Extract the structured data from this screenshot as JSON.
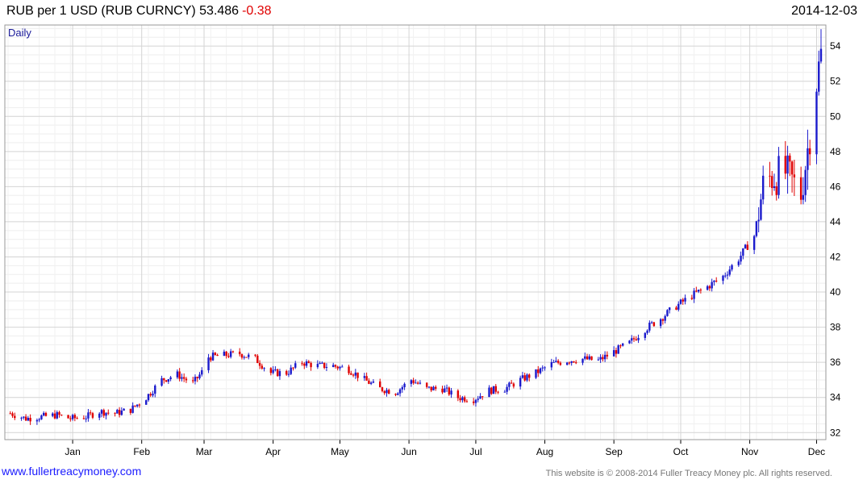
{
  "header": {
    "title": "RUB per 1 USD (RUB CURNCY) 53.486",
    "change": "-0.38",
    "date": "2014-12-03"
  },
  "footer": {
    "website": "www.fullertreacymoney.com",
    "copyright": "This website is © 2008-2014 Fuller Treacy Money plc. All rights reserved."
  },
  "colors": {
    "up": "#1a1acc",
    "down": "#e00000",
    "grid": "#d4d4d4"
  },
  "chart_data": {
    "type": "candlestick",
    "period": "Daily",
    "ylim": [
      31.6,
      55.2
    ],
    "yticks": [
      32,
      34,
      36,
      38,
      40,
      42,
      44,
      46,
      48,
      50,
      52,
      54
    ],
    "xlim": [
      "2013-12-03",
      "2014-12-03"
    ],
    "xticks": [
      {
        "label": "Jan",
        "date": "2014-01-01"
      },
      {
        "label": "Feb",
        "date": "2014-02-01"
      },
      {
        "label": "Mar",
        "date": "2014-03-01"
      },
      {
        "label": "Apr",
        "date": "2014-04-01"
      },
      {
        "label": "May",
        "date": "2014-05-01"
      },
      {
        "label": "Jun",
        "date": "2014-06-01"
      },
      {
        "label": "Jul",
        "date": "2014-07-01"
      },
      {
        "label": "Aug",
        "date": "2014-08-01"
      },
      {
        "label": "Sep",
        "date": "2014-09-01"
      },
      {
        "label": "Oct",
        "date": "2014-10-01"
      },
      {
        "label": "Nov",
        "date": "2014-11-01"
      },
      {
        "label": "Dec",
        "date": "2014-12-01"
      }
    ],
    "closes": [
      [
        "2013-12-04",
        33.1
      ],
      [
        "2013-12-11",
        32.8
      ],
      [
        "2013-12-18",
        32.9
      ],
      [
        "2013-12-25",
        33.0
      ],
      [
        "2013-12-31",
        32.8
      ],
      [
        "2014-01-07",
        32.9
      ],
      [
        "2014-01-13",
        33.2
      ],
      [
        "2014-01-20",
        33.1
      ],
      [
        "2014-01-27",
        33.3
      ],
      [
        "2014-02-03",
        34.0
      ],
      [
        "2014-02-10",
        35.0
      ],
      [
        "2014-02-17",
        35.3
      ],
      [
        "2014-02-24",
        34.8
      ],
      [
        "2014-03-01",
        35.6
      ],
      [
        "2014-03-03",
        36.3
      ],
      [
        "2014-03-10",
        36.4
      ],
      [
        "2014-03-17",
        36.5
      ],
      [
        "2014-03-24",
        36.2
      ],
      [
        "2014-03-31",
        35.4
      ],
      [
        "2014-04-07",
        35.4
      ],
      [
        "2014-04-14",
        36.0
      ],
      [
        "2014-04-21",
        35.8
      ],
      [
        "2014-04-28",
        35.8
      ],
      [
        "2014-05-05",
        35.6
      ],
      [
        "2014-05-12",
        35.0
      ],
      [
        "2014-05-19",
        34.5
      ],
      [
        "2014-05-26",
        34.3
      ],
      [
        "2014-06-02",
        35.0
      ],
      [
        "2014-06-09",
        34.5
      ],
      [
        "2014-06-16",
        34.5
      ],
      [
        "2014-06-23",
        34.0
      ],
      [
        "2014-06-30",
        33.9
      ],
      [
        "2014-07-07",
        34.4
      ],
      [
        "2014-07-14",
        34.5
      ],
      [
        "2014-07-21",
        35.0
      ],
      [
        "2014-07-28",
        35.4
      ],
      [
        "2014-08-04",
        35.9
      ],
      [
        "2014-08-11",
        36.1
      ],
      [
        "2014-08-18",
        36.2
      ],
      [
        "2014-08-25",
        36.1
      ],
      [
        "2014-09-01",
        36.6
      ],
      [
        "2014-09-08",
        37.1
      ],
      [
        "2014-09-15",
        37.9
      ],
      [
        "2014-09-22",
        38.5
      ],
      [
        "2014-09-29",
        39.2
      ],
      [
        "2014-10-06",
        39.8
      ],
      [
        "2014-10-13",
        40.3
      ],
      [
        "2014-10-20",
        40.9
      ],
      [
        "2014-10-27",
        41.9
      ],
      [
        "2014-11-03",
        43.2
      ],
      [
        "2014-11-07",
        46.0
      ],
      [
        "2014-11-10",
        46.5
      ],
      [
        "2014-11-17",
        46.8
      ],
      [
        "2014-11-24",
        45.6
      ],
      [
        "2014-11-28",
        49.0
      ],
      [
        "2014-12-01",
        52.0
      ],
      [
        "2014-12-03",
        53.5
      ]
    ]
  }
}
